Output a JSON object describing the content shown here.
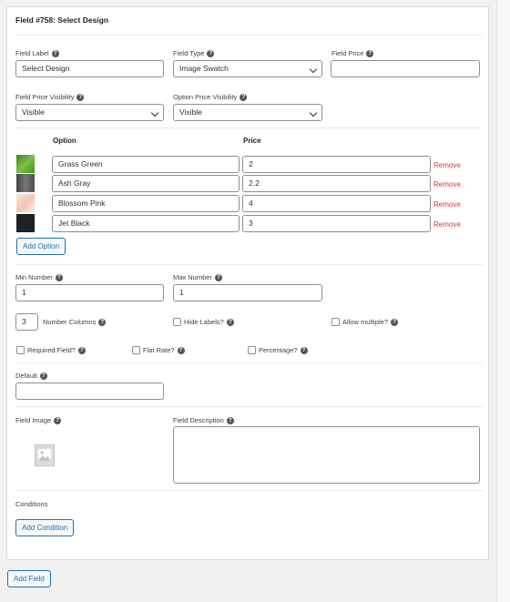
{
  "field_title": "Field #758: Select Design",
  "labels": {
    "field_label": "Field Label",
    "field_type": "Field Type",
    "field_price": "Field Price",
    "field_price_visibility": "Field Price Visibility",
    "option_price_visibility": "Option Price Visibility",
    "min_number": "Min Number",
    "max_number": "Max Number",
    "number_columns": "Number Columns",
    "hide_labels": "Hide Labels?",
    "allow_multiple": "Allow multiple?",
    "required_field": "Required Field?",
    "flat_rate": "Flat Rate?",
    "percentage": "Percentage?",
    "default": "Default",
    "field_image": "Field Image",
    "field_description": "Field Description",
    "conditions": "Conditions"
  },
  "values": {
    "field_label": "Select Design",
    "field_type": "Image Swatch",
    "field_price": "",
    "field_price_visibility": "Visible",
    "option_price_visibility": "Visible",
    "min_number": "1",
    "max_number": "1",
    "number_columns": "3",
    "default": "",
    "field_description": ""
  },
  "options_table": {
    "option_header": "Option",
    "price_header": "Price",
    "rows": [
      {
        "name": "Grass Green",
        "price": "2",
        "remove": "Remove",
        "swatch_color": "#5aa12c"
      },
      {
        "name": "Ash Gray",
        "price": "2.2",
        "remove": "Remove",
        "swatch_color": "#5a5a5a"
      },
      {
        "name": "Blossom Pink",
        "price": "4",
        "remove": "Remove",
        "swatch_color": "#f7d6cc"
      },
      {
        "name": "Jet Black",
        "price": "3",
        "remove": "Remove",
        "swatch_color": "#1e2124"
      }
    ]
  },
  "buttons": {
    "add_option": "Add Option",
    "add_condition": "Add Condition",
    "add_field": "Add Field"
  },
  "help_glyph": "?",
  "icons": {
    "help": "question-circle-icon",
    "chevron": "chevron-down-icon",
    "image_placeholder": "image-placeholder-icon"
  },
  "colors": {
    "accent": "#2271b1",
    "danger": "#d63638",
    "border": "#8c8f94"
  }
}
